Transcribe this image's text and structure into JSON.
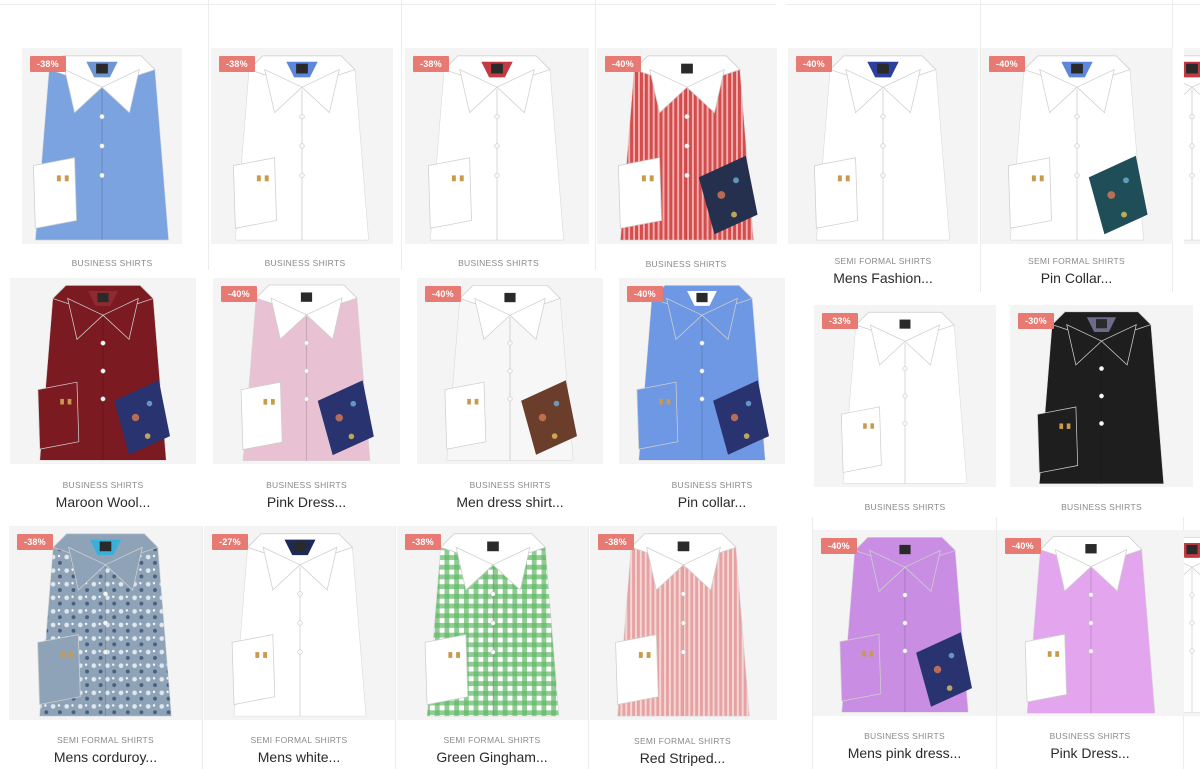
{
  "products": [
    {
      "discount": "-38%",
      "category": "BUSINESS SHIRTS",
      "name": "",
      "colors": {
        "body": "#7ba3df",
        "collar": "#ffffff",
        "pattern": "none",
        "accent": "#6f96d3",
        "tie": "none"
      }
    },
    {
      "discount": "-38%",
      "category": "BUSINESS SHIRTS",
      "name": "",
      "colors": {
        "body": "#ffffff",
        "collar": "#ffffff",
        "pattern": "none",
        "accent": "#5f86dd",
        "tie": "none"
      }
    },
    {
      "discount": "-38%",
      "category": "BUSINESS SHIRTS",
      "name": "",
      "colors": {
        "body": "#ffffff",
        "collar": "#ffffff",
        "pattern": "none",
        "accent": "#c43a43",
        "tie": "none"
      }
    },
    {
      "discount": "-40%",
      "category": "BUSINESS SHIRTS",
      "name": "",
      "colors": {
        "body": "#d64b4b",
        "collar": "#ffffff",
        "pattern": "vstripes",
        "accent": "#ffffff",
        "tie": "#25304f"
      }
    },
    {
      "discount": "-40%",
      "category": "SEMI FORMAL SHIRTS",
      "name": "Mens Fashion...",
      "colors": {
        "body": "#ffffff",
        "collar": "#ffffff",
        "pattern": "none",
        "accent": "#2c3f9e",
        "tie": "none"
      }
    },
    {
      "discount": "-40%",
      "category": "SEMI FORMAL SHIRTS",
      "name": "Pin Collar...",
      "colors": {
        "body": "#ffffff",
        "collar": "#ffffff",
        "pattern": "none",
        "accent": "#5f86dd",
        "tie": "#1f4d58"
      }
    },
    {
      "discount": "",
      "category": "BUSINESS SHIRTS",
      "name": "Maroon Wool...",
      "colors": {
        "body": "#7b1a20",
        "collar": "#7b1a20",
        "pattern": "none",
        "accent": "#8e2a30",
        "tie": "#283370"
      }
    },
    {
      "discount": "-40%",
      "category": "BUSINESS SHIRTS",
      "name": "Pink Dress...",
      "colors": {
        "body": "#e8c2d3",
        "collar": "#ffffff",
        "pattern": "none",
        "accent": "#ffffff",
        "tie": "#283370"
      }
    },
    {
      "discount": "-40%",
      "category": "BUSINESS SHIRTS",
      "name": "Men dress shirt...",
      "colors": {
        "body": "#f7f7f7",
        "collar": "#ffffff",
        "pattern": "none",
        "accent": "#ffffff",
        "tie": "#6b3e2b"
      }
    },
    {
      "discount": "-40%",
      "category": "BUSINESS SHIRTS",
      "name": "Pin collar...",
      "colors": {
        "body": "#6e98e4",
        "collar": "#6e98e4",
        "pattern": "none",
        "accent": "#ffffff",
        "tie": "#283370"
      }
    },
    {
      "discount": "-33%",
      "category": "BUSINESS SHIRTS",
      "name": "",
      "colors": {
        "body": "#ffffff",
        "collar": "#ffffff",
        "pattern": "none",
        "accent": "#ffffff",
        "tie": "none"
      }
    },
    {
      "discount": "-30%",
      "category": "BUSINESS SHIRTS",
      "name": "",
      "colors": {
        "body": "#1e1e1e",
        "collar": "#1e1e1e",
        "pattern": "none",
        "accent": "#6b6b8a",
        "tie": "none"
      }
    },
    {
      "discount": "-38%",
      "category": "SEMI FORMAL SHIRTS",
      "name": "Mens corduroy...",
      "colors": {
        "body": "#8ea3b8",
        "collar": "#8ea3b8",
        "pattern": "floral",
        "accent": "#38b0d9",
        "tie": "none"
      }
    },
    {
      "discount": "-27%",
      "category": "SEMI FORMAL SHIRTS",
      "name": "Mens white...",
      "colors": {
        "body": "#ffffff",
        "collar": "#ffffff",
        "pattern": "none",
        "accent": "#1e2a55",
        "tie": "none"
      }
    },
    {
      "discount": "-38%",
      "category": "SEMI FORMAL SHIRTS",
      "name": "Green Gingham...",
      "colors": {
        "body": "#5fb865",
        "collar": "#ffffff",
        "pattern": "gingham",
        "accent": "#ffffff",
        "tie": "none"
      }
    },
    {
      "discount": "-38%",
      "category": "SEMI FORMAL SHIRTS",
      "name": "Red Striped...",
      "colors": {
        "body": "#e7a3a3",
        "collar": "#ffffff",
        "pattern": "vstripes",
        "accent": "#ffffff",
        "tie": "none"
      }
    },
    {
      "discount": "-40%",
      "category": "BUSINESS SHIRTS",
      "name": "Mens pink dress...",
      "colors": {
        "body": "#c98ee3",
        "collar": "#c98ee3",
        "pattern": "none",
        "accent": "#c98ee3",
        "tie": "#283370"
      }
    },
    {
      "discount": "-40%",
      "category": "BUSINESS SHIRTS",
      "name": "Pink Dress...",
      "colors": {
        "body": "#e3a6ee",
        "collar": "#ffffff",
        "pattern": "none",
        "accent": "#ffffff",
        "tie": "none"
      }
    },
    {
      "discount": "",
      "category": "",
      "name": "",
      "colors": {
        "body": "#ffffff",
        "collar": "#ffffff",
        "pattern": "none",
        "accent": "#c43a43",
        "tie": "none"
      }
    },
    {
      "discount": "",
      "category": "",
      "name": "",
      "colors": {
        "body": "#ffffff",
        "collar": "#ffffff",
        "pattern": "none",
        "accent": "#c43a43",
        "tie": "none"
      }
    }
  ]
}
